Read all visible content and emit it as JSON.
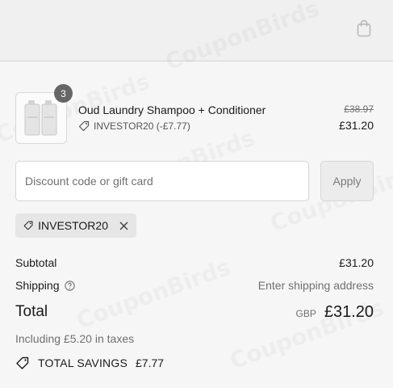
{
  "header": {
    "bag_icon": "shopping-bag-icon"
  },
  "cart_item": {
    "quantity": "3",
    "title": "Oud Laundry Shampoo + Conditioner",
    "discount_text": "INVESTOR20 (-£7.77)",
    "price_original": "£38.97",
    "price_final": "£31.20"
  },
  "discount": {
    "placeholder": "Discount code or gift card",
    "apply_label": "Apply",
    "applied_code": "INVESTOR20"
  },
  "summary": {
    "subtotal_label": "Subtotal",
    "subtotal_value": "£31.20",
    "shipping_label": "Shipping",
    "shipping_value": "Enter shipping address",
    "total_label": "Total",
    "currency": "GBP",
    "total_value": "£31.20",
    "taxes_text": "Including £5.20 in taxes",
    "savings_label": "TOTAL SAVINGS",
    "savings_value": "£7.77"
  },
  "watermark": "CouponBirds"
}
